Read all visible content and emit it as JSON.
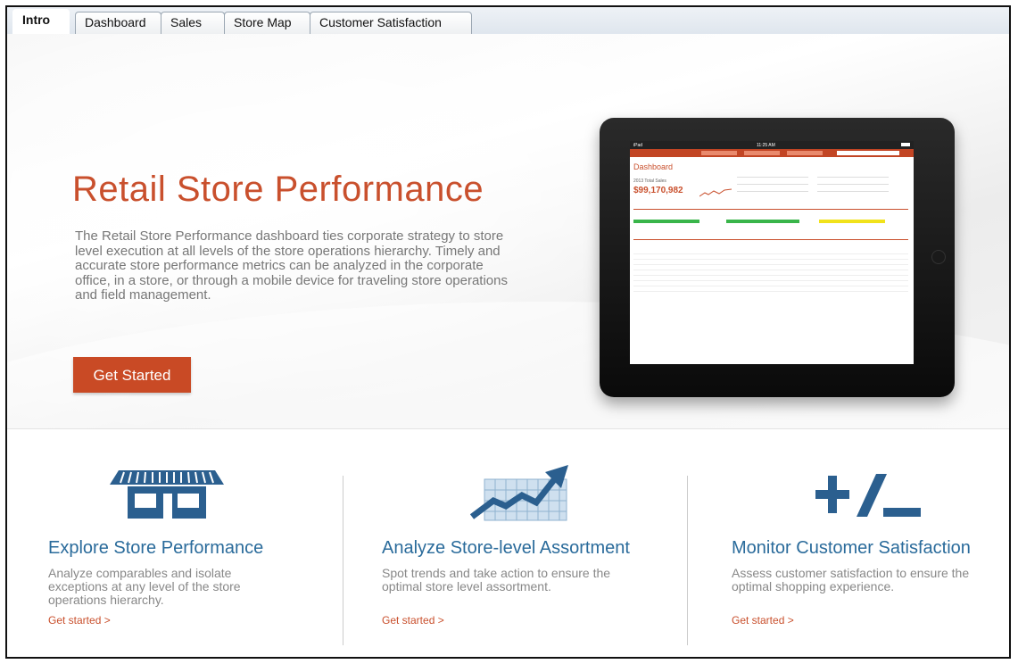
{
  "tabs": [
    {
      "label": "Intro",
      "active": true
    },
    {
      "label": "Dashboard",
      "active": false
    },
    {
      "label": "Sales",
      "active": false
    },
    {
      "label": "Store Map",
      "active": false
    },
    {
      "label": "Customer Satisfaction",
      "active": false
    }
  ],
  "hero": {
    "title": "Retail Store Performance",
    "description": "The Retail Store Performance dashboard ties corporate strategy to store level execution at all levels of the store operations hierarchy.  Timely and accurate store performance metrics can be analyzed in the corporate office, in a store, or through a mobile device for traveling store operations and field management.",
    "cta_label": "Get Started"
  },
  "tablet": {
    "status_left": "iPad",
    "status_time": "11:25 AM",
    "screen_title": "Dashboard",
    "screen_total_label": "2013 Total Sales",
    "screen_total_value": "$99,170,982"
  },
  "features": [
    {
      "icon": "storefront-icon",
      "title": "Explore Store Performance",
      "description": "Analyze comparables and isolate exceptions at any level of the store operations hierarchy.",
      "link": "Get started >"
    },
    {
      "icon": "trend-chart-icon",
      "title": "Analyze Store-level Assortment",
      "description": "Spot trends and take action to ensure the optimal store level assortment.",
      "link": "Get started >"
    },
    {
      "icon": "plus-minus-icon",
      "title": "Monitor Customer Satisfaction",
      "description": "Assess customer satisfaction to ensure the optimal shopping experience.",
      "link": "Get started >"
    }
  ],
  "colors": {
    "accent": "#c94a25",
    "feature_blue": "#2a6b9b",
    "icon_blue": "#2b5f8f"
  }
}
